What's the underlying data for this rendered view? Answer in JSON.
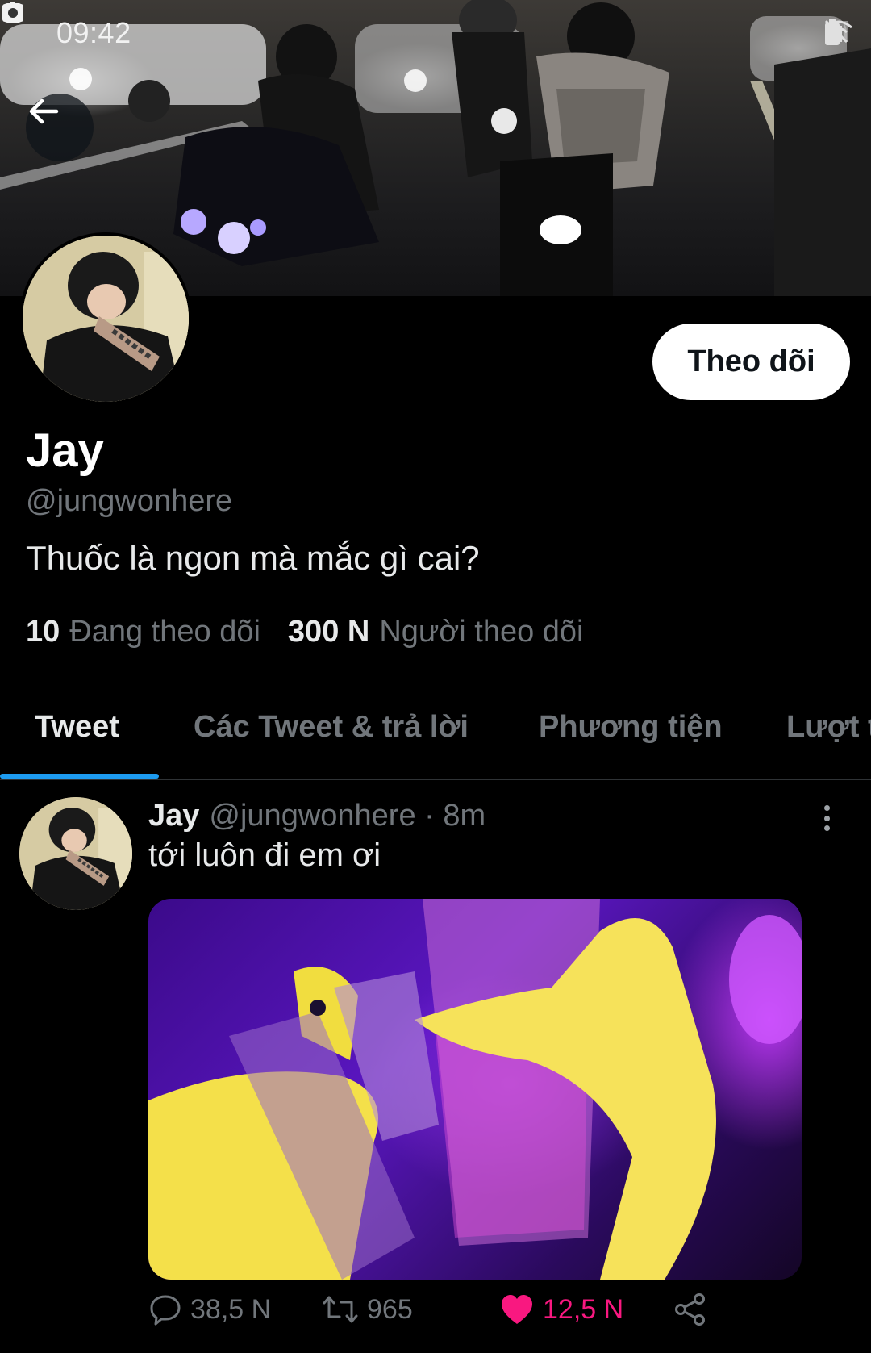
{
  "status_bar": {
    "time": "09:42"
  },
  "profile": {
    "display_name": "Jay",
    "handle": "@jungwonhere",
    "bio": "Thuốc là ngon mà mắc gì cai?",
    "follow_label": "Theo dõi",
    "following_count": "10",
    "following_label": "Đang theo dõi",
    "followers_count": "300 N",
    "followers_label": "Người theo dõi"
  },
  "tabs": [
    {
      "label": "Tweet",
      "active": true
    },
    {
      "label": "Các Tweet & trả lời",
      "active": false
    },
    {
      "label": "Phương tiện",
      "active": false
    },
    {
      "label": "Lượt t",
      "active": false
    }
  ],
  "tweet": {
    "name": "Jay",
    "handle": "@jungwonhere",
    "separator": "·",
    "time": "8m",
    "text": "tới luôn đi em ơi",
    "actions": {
      "replies": "38,5 N",
      "retweets": "965",
      "likes": "12,5 N"
    }
  },
  "colors": {
    "accent": "#1d9bf0",
    "like": "#f91880",
    "secondary_text": "#71767b"
  },
  "icons": [
    "back-arrow-icon",
    "gallery-icon",
    "timer-icon",
    "record-icon",
    "mute-icon",
    "wifi-icon",
    "signal-icon",
    "battery-icon",
    "reply-icon",
    "retweet-icon",
    "heart-icon",
    "share-icon",
    "more-vertical-icon"
  ]
}
